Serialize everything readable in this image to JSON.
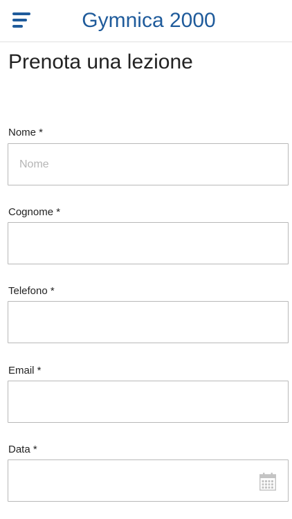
{
  "header": {
    "title": "Gymnica 2000",
    "menu_icon": "hamburger-menu-icon"
  },
  "page": {
    "title": "Prenota una lezione"
  },
  "form": {
    "fields": [
      {
        "label": "Nome *",
        "placeholder": "Nome",
        "value": ""
      },
      {
        "label": "Cognome *",
        "placeholder": "",
        "value": ""
      },
      {
        "label": "Telefono *",
        "placeholder": "",
        "value": ""
      },
      {
        "label": "Email *",
        "placeholder": "",
        "value": ""
      },
      {
        "label": "Data *",
        "placeholder": "",
        "value": "",
        "icon": "calendar-icon"
      }
    ]
  },
  "colors": {
    "brand": "#1f5b9b",
    "input_border": "#b8b8b8",
    "placeholder": "#b5b5b5",
    "icon": "#c4c4c4"
  }
}
